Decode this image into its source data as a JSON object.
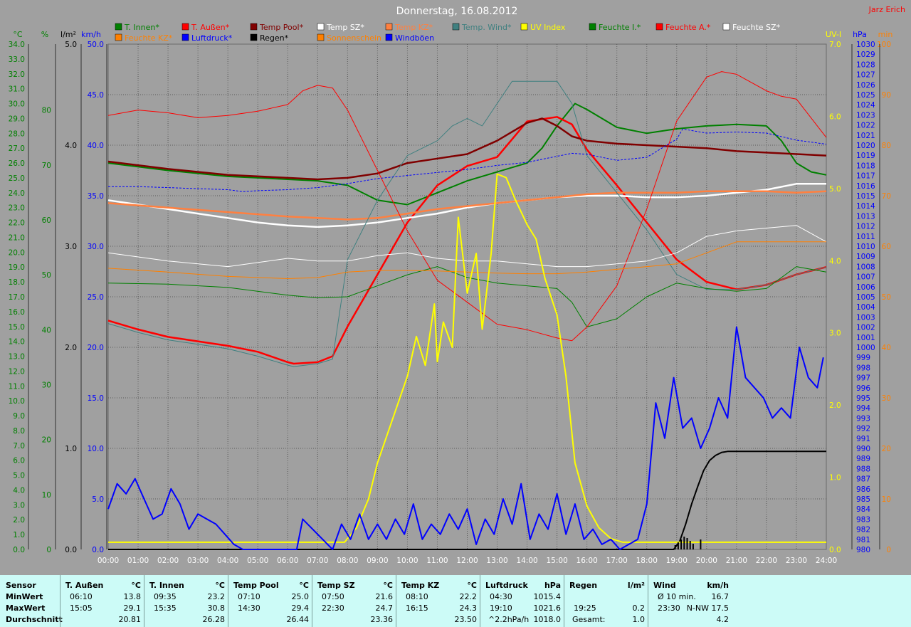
{
  "header": {
    "title": "Donnerstag, 16.08.2012",
    "author": "Jarz Erich"
  },
  "legend": [
    {
      "label": "T. Innen*",
      "color": "#008000"
    },
    {
      "label": "T. Außen*",
      "color": "#ff0000"
    },
    {
      "label": "Temp Pool*",
      "color": "#800000"
    },
    {
      "label": "Temp SZ*",
      "color": "#ffffff"
    },
    {
      "label": "Temp KZ*",
      "color": "#ff8040"
    },
    {
      "label": "Temp. Wind*",
      "color": "#408080"
    },
    {
      "label": "UV Index",
      "color": "#ffff00"
    },
    {
      "label": "Feuchte I.*",
      "color": "#008000"
    },
    {
      "label": "Feuchte A.*",
      "color": "#ff0000"
    },
    {
      "label": "Feuchte SZ*",
      "color": "#ffffff"
    },
    {
      "label": "Feuchte KZ*",
      "color": "#ff8000"
    },
    {
      "label": "Luftdruck*",
      "color": "#0000ff"
    },
    {
      "label": "Regen*",
      "color": "#000000"
    },
    {
      "label": "Sonnenschein",
      "color": "#ff8000"
    },
    {
      "label": "Windböen",
      "color": "#0000ff"
    }
  ],
  "axis_units": {
    "celsius": "°C",
    "percent": "%",
    "rain": "l/m²",
    "wind": "km/h",
    "uv": "UV-I",
    "pressure": "hPa",
    "minutes": "min"
  },
  "chart_data": {
    "type": "line",
    "title": "Donnerstag, 16.08.2012",
    "grid": true,
    "x": {
      "label": "",
      "ticks": [
        "00:00",
        "01:00",
        "02:00",
        "03:00",
        "04:00",
        "05:00",
        "06:00",
        "07:00",
        "08:00",
        "09:00",
        "10:00",
        "11:00",
        "12:00",
        "13:00",
        "14:00",
        "15:00",
        "16:00",
        "17:00",
        "18:00",
        "19:00",
        "20:00",
        "21:00",
        "22:00",
        "23:00",
        "24:00"
      ],
      "range": [
        0,
        24
      ],
      "unit": "h"
    },
    "axes": {
      "temp": {
        "unit": "°C",
        "range": [
          0,
          34
        ]
      },
      "humidity": {
        "unit": "%",
        "range": [
          0,
          92
        ]
      },
      "rain": {
        "unit": "l/m²",
        "range": [
          0,
          5
        ]
      },
      "wind": {
        "unit": "km/h",
        "range": [
          0,
          50
        ]
      },
      "uv": {
        "unit": "UV-I",
        "range": [
          0,
          7
        ]
      },
      "pressure": {
        "unit": "hPa",
        "range": [
          980,
          1030
        ]
      },
      "sun": {
        "unit": "min",
        "range": [
          0,
          100
        ]
      }
    },
    "series": [
      {
        "name": "T. Innen*",
        "axis": "temp",
        "color": "#008000",
        "width": 2,
        "x": [
          0,
          2,
          4,
          6,
          7,
          8,
          9,
          10,
          11,
          12,
          13,
          14,
          14.5,
          15,
          15.6,
          16,
          17,
          18,
          19,
          20,
          21,
          22,
          22.5,
          23,
          23.5,
          24
        ],
        "y": [
          26,
          25.5,
          25.1,
          24.9,
          24.8,
          24.5,
          23.5,
          23.2,
          24,
          24.8,
          25.4,
          26,
          27,
          28.5,
          30,
          29.6,
          28.4,
          28,
          28.3,
          28.5,
          28.6,
          28.5,
          27.5,
          26,
          25.4,
          25.2
        ]
      },
      {
        "name": "T. Außen*",
        "axis": "temp",
        "color": "#ff0000",
        "width": 2.5,
        "x": [
          0,
          1,
          2,
          3,
          4,
          5,
          6,
          6.2,
          7,
          7.5,
          8,
          9,
          10,
          11,
          12,
          13,
          14,
          15,
          15.5,
          16,
          17,
          18,
          19,
          20,
          21,
          22,
          23,
          24
        ],
        "y": [
          15.4,
          14.8,
          14.3,
          14,
          13.7,
          13.3,
          12.6,
          12.5,
          12.6,
          13,
          15,
          18.5,
          22,
          24.5,
          25.8,
          26.4,
          28.8,
          29.1,
          28.6,
          26.9,
          24.5,
          22,
          19.5,
          18,
          17.5,
          17.8,
          18.5,
          19
        ]
      },
      {
        "name": "Temp Pool*",
        "axis": "temp",
        "color": "#800000",
        "width": 2.5,
        "x": [
          0,
          2,
          4,
          6,
          7,
          8,
          9,
          10,
          11,
          12,
          13,
          14,
          14.5,
          15,
          15.5,
          16,
          17,
          18,
          19,
          20,
          21,
          22,
          23,
          24
        ],
        "y": [
          26.1,
          25.6,
          25.2,
          25,
          24.9,
          25,
          25.3,
          26,
          26.3,
          26.6,
          27.5,
          28.7,
          29,
          28.5,
          27.8,
          27.5,
          27.3,
          27.2,
          27.1,
          27,
          26.8,
          26.7,
          26.6,
          26.5
        ]
      },
      {
        "name": "Temp SZ*",
        "axis": "temp",
        "color": "#ffffff",
        "width": 2.5,
        "x": [
          0,
          1,
          2,
          3,
          4,
          5,
          6,
          7,
          8,
          9,
          10,
          11,
          12,
          13,
          14,
          15,
          16,
          17,
          18,
          19,
          20,
          21,
          22,
          23,
          24
        ],
        "y": [
          23.5,
          23.2,
          22.9,
          22.6,
          22.3,
          22,
          21.8,
          21.7,
          21.8,
          22,
          22.3,
          22.6,
          23,
          23.3,
          23.5,
          23.7,
          23.8,
          23.8,
          23.7,
          23.7,
          23.8,
          24,
          24.2,
          24.6,
          24.6
        ]
      },
      {
        "name": "Temp KZ*",
        "axis": "temp",
        "color": "#ff8040",
        "width": 2.5,
        "x": [
          0,
          2,
          4,
          6,
          7,
          8,
          9,
          10,
          11,
          12,
          13,
          14,
          15,
          16,
          17,
          18,
          19,
          20,
          21,
          22,
          23,
          24
        ],
        "y": [
          23.3,
          23,
          22.7,
          22.4,
          22.3,
          22.2,
          22.3,
          22.6,
          22.9,
          23.1,
          23.3,
          23.5,
          23.7,
          23.9,
          24,
          24,
          24,
          24.1,
          24.1,
          24.1,
          24,
          24.1
        ]
      },
      {
        "name": "Temp. Wind*",
        "axis": "temp",
        "color": "#408080",
        "width": 1,
        "x": [
          0,
          1,
          2,
          3,
          4,
          5,
          6,
          6.2,
          7,
          7.5,
          8,
          9,
          10,
          11,
          11.5,
          12,
          12.5,
          13,
          13.5,
          14,
          15,
          15.5,
          16,
          17,
          18,
          19,
          20,
          21,
          22,
          23,
          24
        ],
        "y": [
          15.2,
          14.6,
          14.1,
          13.8,
          13.5,
          13,
          12.4,
          12.3,
          12.5,
          12.8,
          19.5,
          23.5,
          26.5,
          27.5,
          28.5,
          29,
          28.5,
          30,
          31.5,
          31.5,
          31.5,
          30,
          26.5,
          24,
          21.5,
          18.5,
          17.5,
          17.5,
          17.8,
          18.5,
          19
        ]
      },
      {
        "name": "Feuchte I.*",
        "axis": "humidity",
        "color": "#008000",
        "width": 1,
        "x": [
          0,
          2,
          4,
          6,
          7,
          8,
          10,
          11,
          12,
          13,
          14,
          15,
          15.5,
          16,
          17,
          18,
          19,
          20,
          21,
          22,
          23,
          24
        ],
        "y": [
          48.5,
          48.3,
          47.7,
          46.3,
          45.8,
          46,
          50,
          51.5,
          49.5,
          48.5,
          48,
          47.5,
          45,
          40.5,
          42,
          46,
          48.5,
          47.5,
          47,
          47.5,
          51.5,
          50.5
        ]
      },
      {
        "name": "Feuchte A.*",
        "axis": "humidity",
        "color": "#ff0000",
        "width": 1,
        "x": [
          0,
          1,
          2,
          3,
          4,
          5,
          6,
          6.5,
          7,
          7.5,
          8,
          9,
          10,
          11,
          12,
          13,
          14,
          15,
          15.5,
          16,
          17,
          18,
          19,
          20,
          20.5,
          21,
          22,
          22.5,
          23,
          24
        ],
        "y": [
          79,
          80,
          79.5,
          78.6,
          79,
          79.8,
          81,
          83.5,
          84.5,
          84,
          80,
          69,
          58,
          49,
          45,
          41,
          40,
          38.5,
          38,
          40.5,
          48,
          62,
          78,
          86,
          87,
          86.5,
          83.5,
          82.5,
          82,
          75
        ]
      },
      {
        "name": "Feuchte SZ*",
        "axis": "humidity",
        "color": "#ffffff",
        "width": 1,
        "x": [
          0,
          2,
          4,
          6,
          7,
          8,
          9,
          10,
          11,
          12,
          13,
          14,
          15,
          16,
          17,
          18,
          19,
          20,
          21,
          22,
          23,
          24
        ],
        "y": [
          54,
          52.5,
          51.5,
          53,
          52.5,
          52.5,
          53.5,
          54,
          53,
          52.5,
          52.5,
          52,
          51.5,
          51.5,
          52,
          52.5,
          54,
          57,
          58,
          58.5,
          59,
          56
        ]
      },
      {
        "name": "Feuchte KZ*",
        "axis": "humidity",
        "color": "#ff8000",
        "width": 1,
        "x": [
          0,
          2,
          4,
          6,
          7,
          8,
          9,
          10,
          11,
          12,
          13,
          14,
          15,
          16,
          17,
          18,
          19,
          20,
          21,
          22,
          23,
          24
        ],
        "y": [
          51.2,
          50.5,
          49.7,
          49.3,
          49.5,
          50.5,
          50.8,
          50.8,
          50.7,
          50.5,
          50.3,
          50.2,
          50.2,
          50.5,
          51,
          51.5,
          52,
          54,
          56,
          56,
          56,
          56
        ]
      },
      {
        "name": "Luftdruck*",
        "axis": "pressure",
        "color": "#0000ff",
        "width": 1,
        "dash": "3,2",
        "x": [
          0,
          1,
          2,
          3,
          4,
          4.5,
          5,
          6,
          7,
          8,
          9,
          10,
          11,
          12,
          13,
          14,
          15,
          15.5,
          16,
          17,
          18,
          19,
          19.2,
          20,
          21,
          22,
          23,
          24
        ],
        "y": [
          1015.9,
          1015.9,
          1015.8,
          1015.7,
          1015.6,
          1015.4,
          1015.5,
          1015.6,
          1015.8,
          1016.2,
          1016.7,
          1017,
          1017.3,
          1017.6,
          1018,
          1018.3,
          1018.9,
          1019.2,
          1019.1,
          1018.5,
          1018.8,
          1020.6,
          1021.6,
          1021.2,
          1021.3,
          1021.2,
          1020.5,
          1020.1
        ]
      },
      {
        "name": "Regen*",
        "axis": "rain",
        "color": "#000000",
        "width": 2,
        "x": [
          0,
          18.9,
          19.1,
          19.3,
          19.5,
          19.7,
          19.9,
          20.1,
          20.3,
          20.5,
          20.7,
          21,
          22,
          23,
          24
        ],
        "y": [
          0,
          0,
          0.08,
          0.25,
          0.45,
          0.62,
          0.78,
          0.88,
          0.93,
          0.96,
          0.97,
          0.97,
          0.97,
          0.97,
          0.97
        ]
      },
      {
        "name": "UV Index",
        "axis": "uv",
        "color": "#ffff00",
        "width": 2,
        "x": [
          0,
          7.9,
          8.3,
          8.7,
          9,
          9.5,
          10,
          10.3,
          10.6,
          10.9,
          11,
          11.2,
          11.5,
          11.7,
          12,
          12.3,
          12.5,
          12.8,
          13,
          13.3,
          13.6,
          14,
          14.3,
          14.6,
          15,
          15.3,
          15.6,
          16,
          16.4,
          16.8,
          17.2,
          17.8,
          18,
          24
        ],
        "y": [
          0.1,
          0.1,
          0.3,
          0.7,
          1.2,
          1.8,
          2.4,
          2.95,
          2.55,
          3.4,
          2.6,
          3.15,
          2.8,
          4.6,
          3.55,
          4.1,
          3.05,
          4.1,
          5.2,
          5.15,
          4.85,
          4.5,
          4.3,
          3.75,
          3.25,
          2.4,
          1.2,
          0.6,
          0.3,
          0.15,
          0.1,
          0.1,
          0.1,
          0.1
        ]
      },
      {
        "name": "Windböen",
        "axis": "wind",
        "color": "#0000ff",
        "width": 2,
        "x": [
          0,
          0.3,
          0.6,
          0.9,
          1.2,
          1.5,
          1.8,
          2.1,
          2.4,
          2.7,
          3,
          3.3,
          3.6,
          3.9,
          4.2,
          4.5,
          6.3,
          6.5,
          7.5,
          7.8,
          8.1,
          8.4,
          8.7,
          9,
          9.3,
          9.6,
          9.9,
          10.2,
          10.5,
          10.8,
          11.1,
          11.4,
          11.7,
          12,
          12.3,
          12.6,
          12.9,
          13.2,
          13.5,
          13.8,
          14.1,
          14.4,
          14.7,
          15,
          15.3,
          15.6,
          15.9,
          16.2,
          16.5,
          16.8,
          17.1,
          17.4,
          17.7,
          18,
          18.3,
          18.6,
          18.9,
          19.2,
          19.5,
          19.8,
          20.1,
          20.4,
          20.7,
          21,
          21.3,
          21.6,
          21.9,
          22.2,
          22.5,
          22.8,
          23.1,
          23.4,
          23.7,
          23.9
        ],
        "y": [
          4,
          6.5,
          5.5,
          7,
          5,
          3,
          3.5,
          6,
          4.5,
          2,
          3.5,
          3,
          2.5,
          1.5,
          0.5,
          0,
          0,
          3,
          0,
          2.5,
          1,
          3.5,
          1,
          2.5,
          1,
          3,
          1.5,
          4.5,
          1,
          2.5,
          1.5,
          3.5,
          2,
          4,
          0.5,
          3,
          1.5,
          5,
          2.5,
          6.5,
          1,
          3.5,
          2,
          5.5,
          1.5,
          4.5,
          1,
          2,
          0.5,
          1,
          0,
          0.5,
          1,
          4.5,
          14.5,
          11,
          17,
          12,
          13,
          10,
          12,
          15,
          13,
          22,
          17,
          16,
          15,
          13,
          14,
          13,
          20,
          17,
          16,
          19
        ]
      }
    ]
  },
  "stats": {
    "rows": [
      "Sensor",
      "MinWert",
      "MaxWert",
      "Durchschnitt"
    ],
    "columns": [
      {
        "name": "T. Außen",
        "unit": "°C",
        "min_time": "06:10",
        "min": "13.8",
        "max_time": "15:05",
        "max": "29.1",
        "avg_label": "",
        "avg": "20.81"
      },
      {
        "name": "T. Innen",
        "unit": "°C",
        "min_time": "09:35",
        "min": "23.2",
        "max_time": "15:35",
        "max": "30.8",
        "avg_label": "",
        "avg": "26.28"
      },
      {
        "name": "Temp Pool",
        "unit": "°C",
        "min_time": "07:10",
        "min": "25.0",
        "max_time": "14:30",
        "max": "29.4",
        "avg_label": "",
        "avg": "26.44"
      },
      {
        "name": "Temp SZ",
        "unit": "°C",
        "min_time": "07:50",
        "min": "21.6",
        "max_time": "22:30",
        "max": "24.7",
        "avg_label": "",
        "avg": "23.36"
      },
      {
        "name": "Temp KZ",
        "unit": "°C",
        "min_time": "08:10",
        "min": "22.2",
        "max_time": "16:15",
        "max": "24.3",
        "avg_label": "",
        "avg": "23.50"
      },
      {
        "name": "Luftdruck",
        "unit": "hPa",
        "min_time": "04:30",
        "min": "1015.4",
        "max_time": "19:10",
        "max": "1021.6",
        "avg_label": "^2.2hPa/h",
        "avg": "1018.0"
      },
      {
        "name": "Regen",
        "unit": "l/m²",
        "min_time": "",
        "min": "",
        "max_time": "19:25",
        "max": "0.2",
        "avg_label": "Gesamt:",
        "avg": "1.0"
      },
      {
        "name": "Wind",
        "unit": "km/h",
        "min_time": "Ø 10 min.",
        "min": "16.7",
        "max_time": "23:30",
        "max": "N-NW 17.5",
        "avg_label": "",
        "avg": "4.2"
      }
    ]
  }
}
